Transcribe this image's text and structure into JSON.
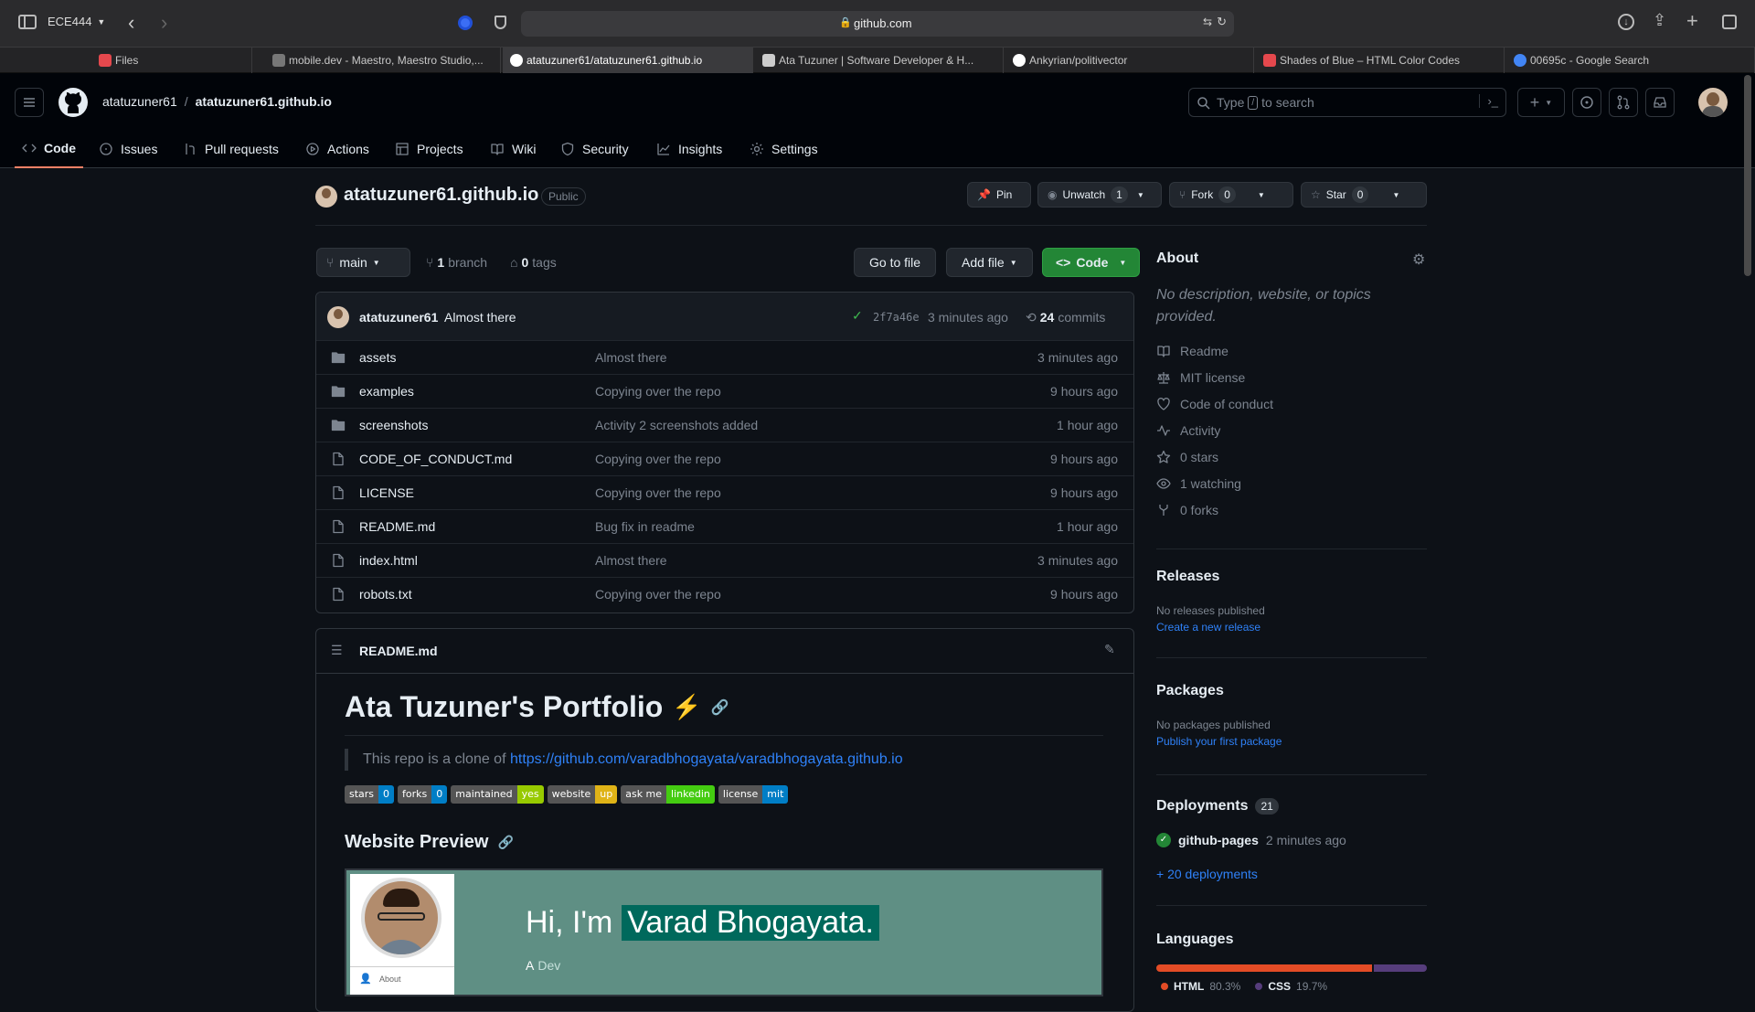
{
  "browser": {
    "profile": "ECE444",
    "url": "github.com",
    "tabs": [
      {
        "label": "Files",
        "color": "#e5484d"
      },
      {
        "label": "mobile.dev - Maestro, Maestro Studio,...",
        "color": "#8b8b8b"
      },
      {
        "label": "atatuzuner61/atatuzuner61.github.io",
        "color": "#ffffff"
      },
      {
        "label": "Ata Tuzuner | Software Developer & H...",
        "color": "#cccccc"
      },
      {
        "label": "Ankyrian/politivector",
        "color": "#ffffff"
      },
      {
        "label": "Shades of Blue – HTML Color Codes",
        "color": "#e5484d"
      },
      {
        "label": "00695c - Google Search",
        "color": "#4285f4"
      }
    ],
    "active_tab": 2
  },
  "header": {
    "owner": "atatuzuner61",
    "separator": "/",
    "repo": "atatuzuner61.github.io",
    "search_prefix": "Type",
    "search_key": "/",
    "search_suffix": "to search"
  },
  "nav": [
    {
      "label": "Code",
      "icon": "code-icon"
    },
    {
      "label": "Issues",
      "icon": "issue-icon"
    },
    {
      "label": "Pull requests",
      "icon": "pull-request-icon"
    },
    {
      "label": "Actions",
      "icon": "play-icon"
    },
    {
      "label": "Projects",
      "icon": "table-icon"
    },
    {
      "label": "Wiki",
      "icon": "book-icon"
    },
    {
      "label": "Security",
      "icon": "shield-icon"
    },
    {
      "label": "Insights",
      "icon": "graph-icon"
    },
    {
      "label": "Settings",
      "icon": "gear-icon"
    }
  ],
  "repo": {
    "name": "atatuzuner61.github.io",
    "visibility": "Public",
    "pin": "Pin",
    "unwatch": "Unwatch",
    "watch_count": "1",
    "fork": "Fork",
    "fork_count": "0",
    "star": "Star",
    "star_count": "0"
  },
  "toolbar": {
    "branch": "main",
    "branch_count": "1",
    "branch_label": "branch",
    "tag_count": "0",
    "tag_label": "tags",
    "goto_file": "Go to file",
    "add_file": "Add file",
    "code": "Code"
  },
  "commit": {
    "author": "atatuzuner61",
    "message": "Almost there",
    "sha": "2f7a46e",
    "time": "3 minutes ago",
    "count": "24",
    "count_label": "commits"
  },
  "files": [
    {
      "name": "assets",
      "type": "dir",
      "message": "Almost there",
      "age": "3 minutes ago"
    },
    {
      "name": "examples",
      "type": "dir",
      "message": "Copying over the repo",
      "age": "9 hours ago"
    },
    {
      "name": "screenshots",
      "type": "dir",
      "message": "Activity 2 screenshots added",
      "age": "1 hour ago"
    },
    {
      "name": "CODE_OF_CONDUCT.md",
      "type": "file",
      "message": "Copying over the repo",
      "age": "9 hours ago"
    },
    {
      "name": "LICENSE",
      "type": "file",
      "message": "Copying over the repo",
      "age": "9 hours ago"
    },
    {
      "name": "README.md",
      "type": "file",
      "message": "Bug fix in readme",
      "age": "1 hour ago"
    },
    {
      "name": "index.html",
      "type": "file",
      "message": "Almost there",
      "age": "3 minutes ago"
    },
    {
      "name": "robots.txt",
      "type": "file",
      "message": "Copying over the repo",
      "age": "9 hours ago"
    }
  ],
  "readme": {
    "filename": "README.md",
    "title": "Ata Tuzuner's Portfolio",
    "title_emoji": "⚡",
    "quote_prefix": "This repo is a clone of",
    "quote_link": "https://github.com/varadbhogayata/varadbhogayata.github.io",
    "badges": [
      {
        "left": "stars",
        "right": "0",
        "color": "#007ec6"
      },
      {
        "left": "forks",
        "right": "0",
        "color": "#007ec6"
      },
      {
        "left": "maintained",
        "right": "yes",
        "color": "#97ca00"
      },
      {
        "left": "website",
        "right": "up",
        "color": "#dfb317"
      },
      {
        "left": "ask me",
        "right": "linkedin",
        "color": "#44cc11"
      },
      {
        "left": "license",
        "right": "mit",
        "color": "#007ec6"
      }
    ],
    "preview_heading": "Website Preview",
    "preview": {
      "greeting": "Hi, I'm",
      "name": "Varad Bhogayata.",
      "sub_prefix": "A",
      "sub_highlight": "Dev",
      "side_item": "About"
    }
  },
  "about": {
    "heading": "About",
    "description": "No description, website, or topics provided.",
    "items": [
      {
        "label": "Readme",
        "icon": "book-icon"
      },
      {
        "label": "MIT license",
        "icon": "law-icon"
      },
      {
        "label": "Code of conduct",
        "icon": "heart-icon"
      },
      {
        "label": "Activity",
        "icon": "pulse-icon"
      },
      {
        "label": "0 stars",
        "icon": "star-icon"
      },
      {
        "label": "1 watching",
        "icon": "eye-icon"
      },
      {
        "label": "0 forks",
        "icon": "fork-icon"
      }
    ]
  },
  "releases": {
    "heading": "Releases",
    "empty": "No releases published",
    "link": "Create a new release"
  },
  "packages": {
    "heading": "Packages",
    "empty": "No packages published",
    "link": "Publish your first package"
  },
  "deployments": {
    "heading": "Deployments",
    "count": "21",
    "env": "github-pages",
    "time": "2 minutes ago",
    "more": "+ 20 deployments"
  },
  "languages": {
    "heading": "Languages",
    "items": [
      {
        "name": "HTML",
        "percent": "80.3%",
        "value": 80.3,
        "color": "#e34c26"
      },
      {
        "name": "CSS",
        "percent": "19.7%",
        "value": 19.7,
        "color": "#563d7c"
      }
    ]
  },
  "colors": {
    "accent": "#238636",
    "link": "#2f81f7",
    "nav_underline": "#f78166"
  }
}
